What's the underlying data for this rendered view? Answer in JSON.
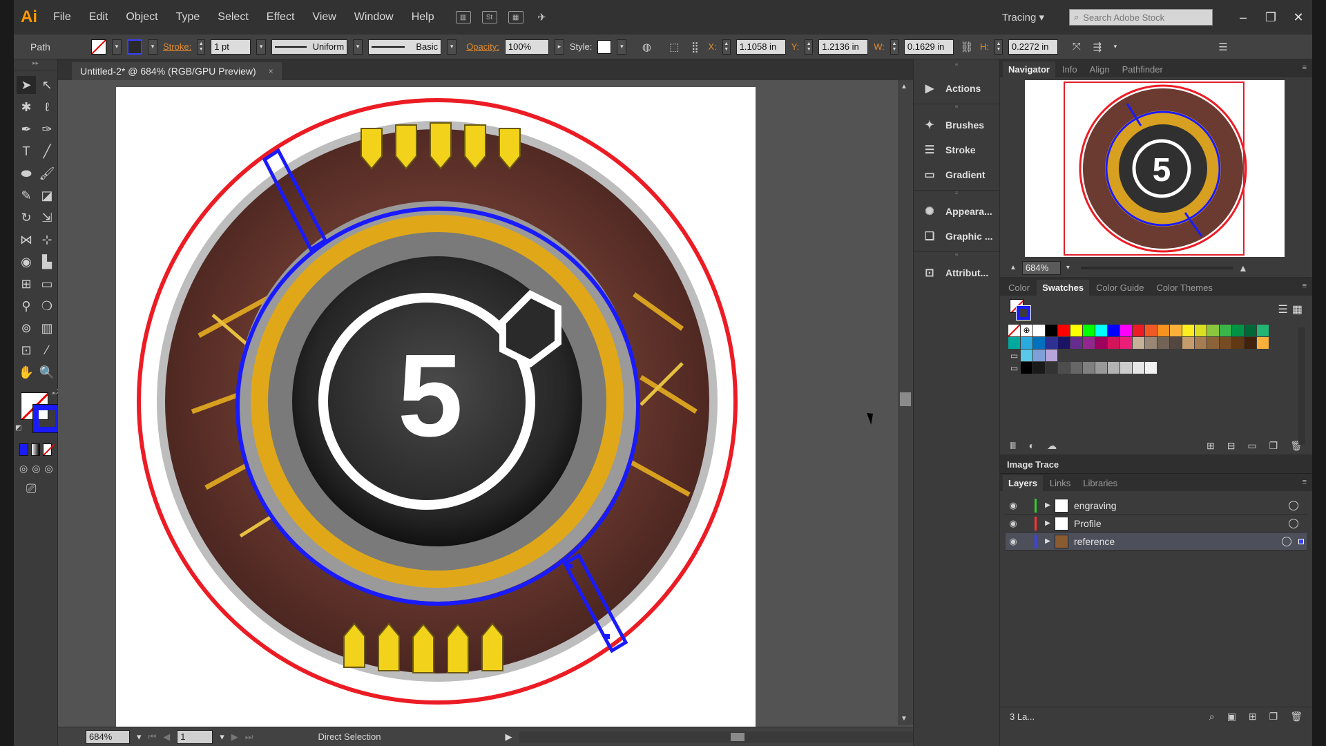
{
  "app": {
    "logo": "Ai"
  },
  "menu": [
    "File",
    "Edit",
    "Object",
    "Type",
    "Select",
    "Effect",
    "View",
    "Window",
    "Help"
  ],
  "menubar_right": {
    "workspace": "Tracing ▾",
    "search_placeholder": "Search Adobe Stock"
  },
  "control": {
    "selection_type": "Path",
    "stroke_label": "Stroke:",
    "stroke_weight": "1 pt",
    "profile": "Uniform",
    "brush": "Basic",
    "opacity_label": "Opacity:",
    "opacity": "100%",
    "style_label": "Style:",
    "x_label": "X:",
    "x": "1.1058 in",
    "y_label": "Y:",
    "y": "1.2136 in",
    "w_label": "W:",
    "w": "0.1629 in",
    "h_label": "H:",
    "h": "0.2272 in"
  },
  "document": {
    "tab_title": "Untitled-2* @ 684% (RGB/GPU Preview)",
    "close": "×"
  },
  "status": {
    "zoom": "684%",
    "page": "1",
    "tool": "Direct Selection"
  },
  "collapsed_panels": [
    {
      "label": "Actions",
      "icon": "play-icon"
    },
    {
      "label": "Brushes",
      "icon": "brush-icon"
    },
    {
      "label": "Stroke",
      "icon": "stroke-lines-icon"
    },
    {
      "label": "Gradient",
      "icon": "gradient-icon"
    },
    {
      "label": "Appeara...",
      "icon": "appearance-icon"
    },
    {
      "label": "Graphic ...",
      "icon": "graphic-styles-icon"
    },
    {
      "label": "Attribut...",
      "icon": "attributes-icon"
    }
  ],
  "navigator": {
    "tabs": [
      "Navigator",
      "Info",
      "Align",
      "Pathfinder"
    ],
    "zoom": "684%"
  },
  "swatches": {
    "tabs": [
      "Color",
      "Swatches",
      "Color Guide",
      "Color Themes"
    ],
    "row1": [
      "#ffffff",
      "#000000",
      "#ff0000",
      "#ffff00",
      "#00ff00",
      "#00ffff",
      "#0000ff",
      "#ff00ff",
      "#ed1c24",
      "#f15a24",
      "#f7931e",
      "#fbb03b",
      "#fcee21",
      "#d9e021",
      "#8cc63f",
      "#39b54a",
      "#009245",
      "#006837",
      "#22b573"
    ],
    "row2": [
      "#00a99d",
      "#29abe2",
      "#0071bc",
      "#2e3192",
      "#1b1464",
      "#662d91",
      "#93278f",
      "#9e005d",
      "#d4145a",
      "#ed1e79",
      "#c7b299",
      "#998675",
      "#736357",
      "#534741",
      "#c69c6d",
      "#a67c52",
      "#8c6239",
      "#754c24",
      "#603813",
      "#42210b",
      "#fbb03b"
    ],
    "row3": [
      "#5ac8e8",
      "#7f9fd8",
      "#b7a4d8"
    ],
    "row4": [
      "#000000",
      "#1a1a1a",
      "#333333",
      "#4d4d4d",
      "#666666",
      "#808080",
      "#999999",
      "#b3b3b3",
      "#cccccc",
      "#e6e6e6",
      "#f2f2f2"
    ]
  },
  "image_trace": {
    "label": "Image Trace"
  },
  "layers": {
    "tabs": [
      "Layers",
      "Links",
      "Libraries"
    ],
    "rows": [
      {
        "name": "engraving",
        "color": "#33cc33"
      },
      {
        "name": "Profile",
        "color": "#ff3333"
      },
      {
        "name": "reference",
        "color": "#3a40ff"
      }
    ],
    "count": "3 La..."
  }
}
